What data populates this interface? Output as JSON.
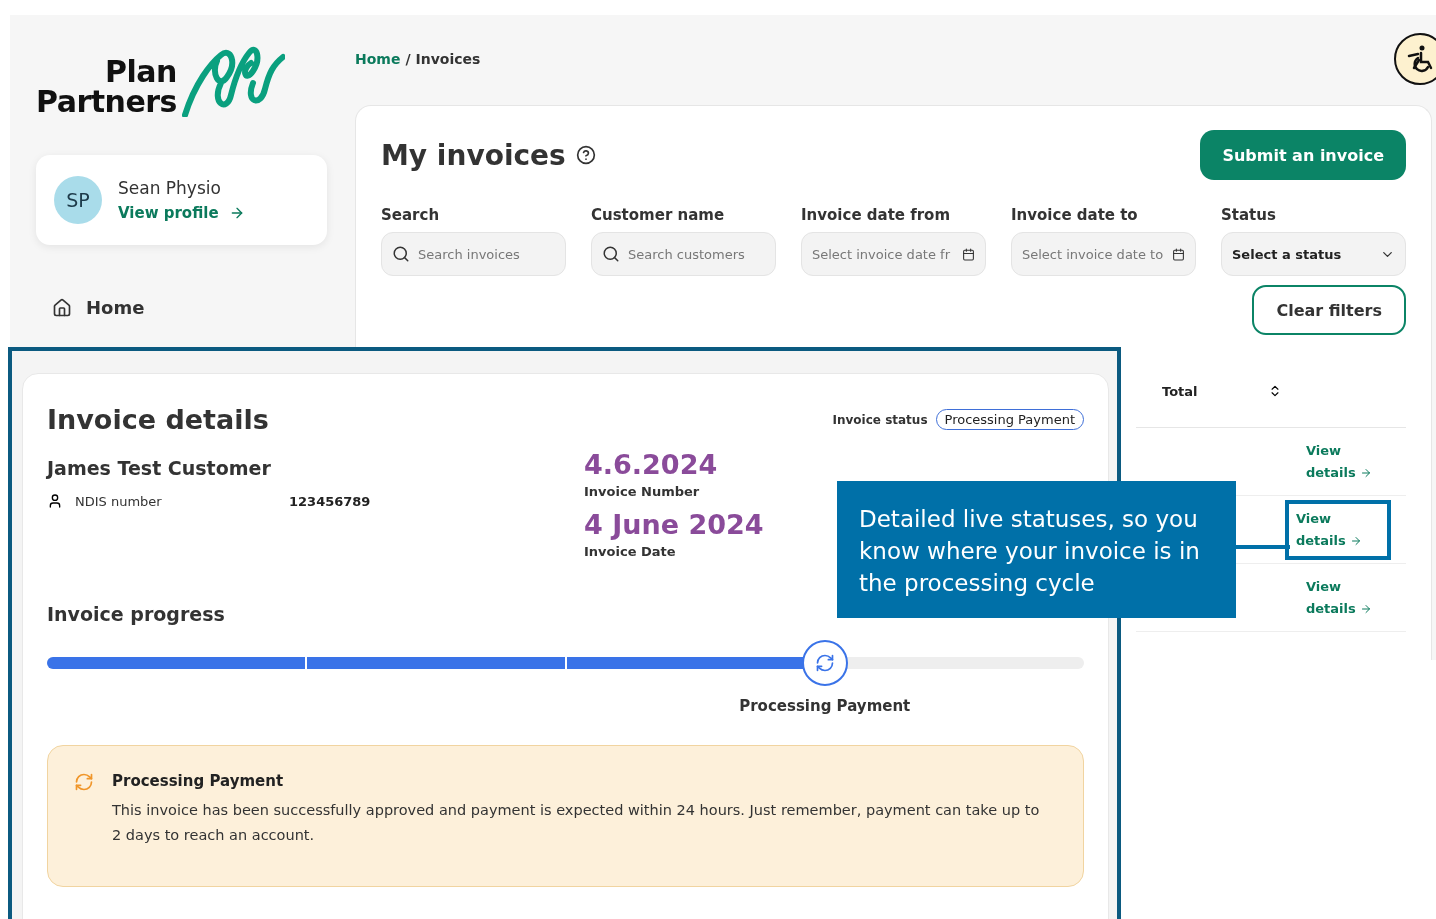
{
  "logo": {
    "line_1": "Plan",
    "line_2": "Partners"
  },
  "breadcrumb": {
    "items": [
      {
        "label": "Home",
        "link": true
      },
      {
        "label": "Invoices",
        "link": false
      }
    ],
    "separator": "/"
  },
  "profile": {
    "initials": "SP",
    "name": "Sean Physio",
    "link": "View profile"
  },
  "nav": [
    {
      "label": "Home"
    }
  ],
  "invoices": {
    "title": "My invoices",
    "submit": "Submit an invoice",
    "filters": [
      {
        "label": "Search",
        "placeholder": "Search invoices",
        "kind": "search"
      },
      {
        "label": "Customer name",
        "placeholder": "Search customers",
        "kind": "search"
      },
      {
        "label": "Invoice date from",
        "placeholder": "Select invoice date fr",
        "kind": "date"
      },
      {
        "label": "Invoice date to",
        "placeholder": "Select invoice date to",
        "kind": "date"
      },
      {
        "label": "Status",
        "value": "Select a status",
        "kind": "select"
      }
    ],
    "clear": "Clear filters",
    "table": {
      "columns": [
        "Total"
      ],
      "rows": [
        {
          "action": "View details",
          "highlighted": false
        },
        {
          "action": "View details",
          "highlighted": true
        },
        {
          "action": "View details",
          "highlighted": false
        }
      ]
    }
  },
  "details": {
    "title": "Invoice details",
    "status_label": "Invoice status",
    "status": "Processing Payment",
    "customer": "James Test Customer",
    "ndis_label": "NDIS number",
    "ndis": "123456789",
    "invoice_number": "4.6.2024",
    "invoice_number_label": "Invoice Number",
    "invoice_date": "4 June 2024",
    "invoice_date_label": "Invoice Date",
    "progress_title": "Invoice progress",
    "progress": {
      "level": 0.75,
      "label": "Processing Payment"
    },
    "alert": {
      "title": "Processing Payment",
      "body": "This invoice has been successfully approved and payment is expected within 24 hours. Just remember, payment can take up to 2 days to reach an account."
    }
  },
  "callout": "Detailed live statuses, so you know where your invoice is in the processing cycle"
}
